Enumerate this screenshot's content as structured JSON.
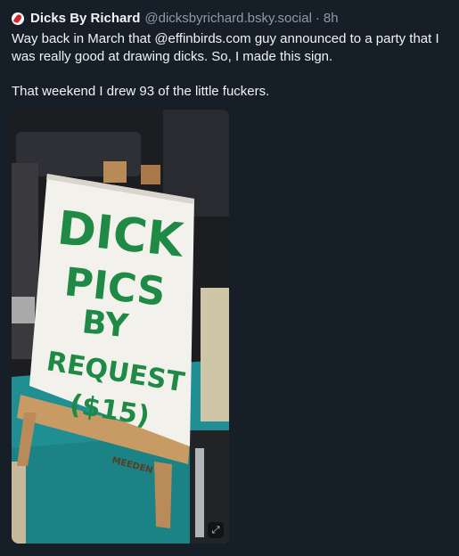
{
  "post": {
    "display_name": "Dicks By Richard",
    "handle": "@dicksbyrichard.bsky.social",
    "separator": "·",
    "time": "8h",
    "paragraphs": [
      "Way back in March that @effinbirds.com guy announced to a party that I was really good at drawing dicks. So, I made this sign.",
      "That weekend I drew 93 of the little fuckers."
    ]
  },
  "media": {
    "sign_lines": [
      "DICK",
      "PICS",
      "BY",
      "REQUEST",
      "($15)"
    ],
    "easel_brand": "MEEDEN",
    "expand_icon": "expand-icon"
  },
  "colors": {
    "background": "#161e27",
    "text": "#f1f3f5",
    "muted": "#8d9bab",
    "sign_ink": "#1f8a45",
    "table_cloth": "#1f8f93"
  }
}
